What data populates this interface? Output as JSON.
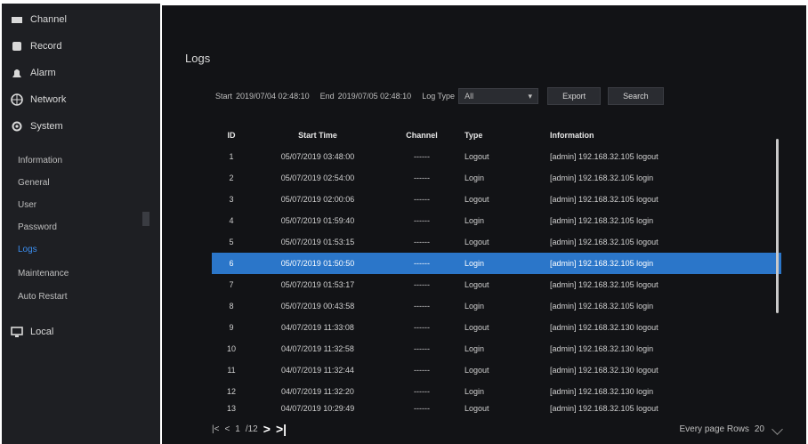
{
  "sidebar": {
    "items": [
      {
        "label": "Channel",
        "icon": "camera-icon"
      },
      {
        "label": "Record",
        "icon": "record-icon"
      },
      {
        "label": "Alarm",
        "icon": "alarm-icon"
      },
      {
        "label": "Network",
        "icon": "network-icon"
      },
      {
        "label": "System",
        "icon": "gear-icon"
      },
      {
        "label": "Local",
        "icon": "monitor-icon"
      }
    ],
    "submenu": [
      {
        "label": "Information"
      },
      {
        "label": "General"
      },
      {
        "label": "User"
      },
      {
        "label": "Password"
      },
      {
        "label": "Logs"
      },
      {
        "label": "Maintenance"
      },
      {
        "label": "Auto Restart"
      }
    ]
  },
  "main": {
    "title": "Logs",
    "filter": {
      "start_label": "Start",
      "start_value": "2019/07/04 02:48:10",
      "end_label": "End",
      "end_value": "2019/07/05 02:48:10",
      "type_label": "Log Type",
      "type_value": "All",
      "export_label": "Export",
      "search_label": "Search"
    },
    "table": {
      "headers": [
        "ID",
        "Start Time",
        "Channel",
        "Type",
        "Information"
      ],
      "rows": [
        {
          "id": "1",
          "time": "05/07/2019 03:48:00",
          "ch": "------",
          "type": "Logout",
          "info": "[admin] 192.168.32.105 logout"
        },
        {
          "id": "2",
          "time": "05/07/2019 02:54:00",
          "ch": "------",
          "type": "Login",
          "info": "[admin] 192.168.32.105 login"
        },
        {
          "id": "3",
          "time": "05/07/2019 02:00:06",
          "ch": "------",
          "type": "Logout",
          "info": "[admin] 192.168.32.105 logout"
        },
        {
          "id": "4",
          "time": "05/07/2019 01:59:40",
          "ch": "------",
          "type": "Login",
          "info": "[admin] 192.168.32.105 login"
        },
        {
          "id": "5",
          "time": "05/07/2019 01:53:15",
          "ch": "------",
          "type": "Logout",
          "info": "[admin] 192.168.32.105 logout"
        },
        {
          "id": "6",
          "time": "05/07/2019 01:50:50",
          "ch": "------",
          "type": "Login",
          "info": "[admin] 192.168.32.105 login"
        },
        {
          "id": "7",
          "time": "05/07/2019 01:53:17",
          "ch": "------",
          "type": "Logout",
          "info": "[admin] 192.168.32.105 logout"
        },
        {
          "id": "8",
          "time": "05/07/2019 00:43:58",
          "ch": "------",
          "type": "Login",
          "info": "[admin] 192.168.32.105 login"
        },
        {
          "id": "9",
          "time": "04/07/2019 11:33:08",
          "ch": "------",
          "type": "Logout",
          "info": "[admin] 192.168.32.130 logout"
        },
        {
          "id": "10",
          "time": "04/07/2019 11:32:58",
          "ch": "------",
          "type": "Login",
          "info": "[admin] 192.168.32.130 login"
        },
        {
          "id": "11",
          "time": "04/07/2019 11:32:44",
          "ch": "------",
          "type": "Logout",
          "info": "[admin] 192.168.32.130 logout"
        },
        {
          "id": "12",
          "time": "04/07/2019 11:32:20",
          "ch": "------",
          "type": "Login",
          "info": "[admin] 192.168.32.130 login"
        },
        {
          "id": "13",
          "time": "04/07/2019 10:29:49",
          "ch": "------",
          "type": "Logout",
          "info": "[admin] 192.168.32.105 logout"
        }
      ]
    },
    "footer": {
      "page_text": "1",
      "page_count": "/12",
      "first_label": "|<",
      "prev_label": "<",
      "next_label": ">",
      "last_label": ">|",
      "per_page_label": "Every page Rows",
      "per_page_value": "20"
    }
  }
}
